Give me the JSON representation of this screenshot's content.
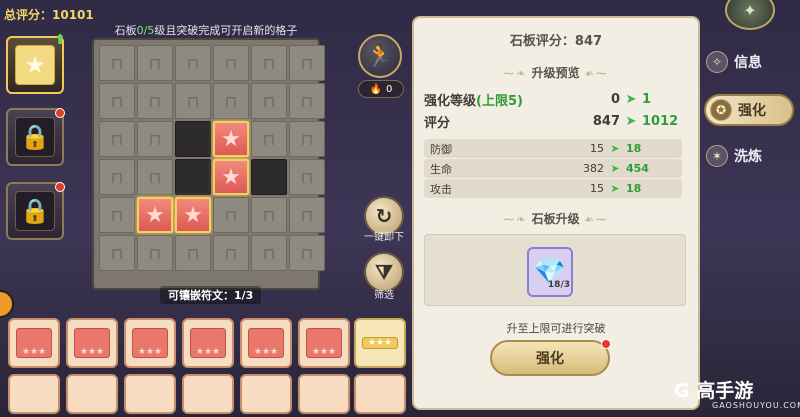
{
  "total_score": "总评分：10101",
  "board": {
    "title_prefix": "石板",
    "title_progress": "0/5",
    "title_suffix": "级且突破完成可开启新的格子",
    "socket_count": "可镶嵌符文：1/3",
    "cells": [
      "lock",
      "lock",
      "lock",
      "lock",
      "lock",
      "lock",
      "lock",
      "lock",
      "lock",
      "lock",
      "lock",
      "lock",
      "lock",
      "lock",
      "empty",
      "star",
      "lock",
      "lock",
      "lock",
      "lock",
      "empty",
      "star",
      "empty",
      "lock",
      "lock",
      "star",
      "star",
      "lock",
      "lock",
      "lock",
      "lock",
      "lock",
      "lock",
      "lock",
      "lock",
      "lock"
    ]
  },
  "middle": {
    "fire_count": "0",
    "unload_label": "一键卸下",
    "filter_label": "筛选"
  },
  "panel": {
    "title": "石板评分：847",
    "preview_head": "升级预览",
    "level_label": "强化等级",
    "level_limit": "(上限5)",
    "level_from": "0",
    "level_to": "1",
    "score_label": "评分",
    "score_from": "847",
    "score_to": "1012",
    "stats": [
      {
        "label": "防御",
        "from": "15",
        "to": "18"
      },
      {
        "label": "生命",
        "from": "382",
        "to": "454"
      },
      {
        "label": "攻击",
        "from": "15",
        "to": "18"
      }
    ],
    "upgrade_head": "石板升级",
    "crystal_count": "18/3",
    "hint": "升至上限可进行突破",
    "button_label": "强化"
  },
  "nav": {
    "info": "信息",
    "strengthen": "强化",
    "refine": "洗炼"
  },
  "watermark": {
    "brand": "G 高手游",
    "domain": "GAOSHOUYOU.COM"
  },
  "colors": {
    "accent_gold": "#f3c95a",
    "green_up": "#2f9c3b",
    "panel_bg": "#f3eee3"
  }
}
